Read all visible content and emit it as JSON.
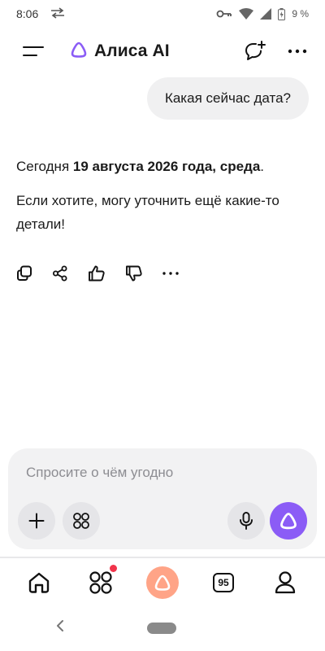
{
  "status_bar": {
    "time": "8:06",
    "battery": "9 %",
    "icons": [
      "data-transfer-icon",
      "vpn-key-icon",
      "wifi-icon",
      "signal-icon",
      "battery-icon"
    ]
  },
  "header": {
    "title": "Алиса AI",
    "icons": [
      "menu-icon",
      "alice-logo-icon",
      "new-chat-icon",
      "more-icon"
    ]
  },
  "chat": {
    "user_message": "Какая сейчас дата?",
    "answer": {
      "line1_prefix": "Сегодня ",
      "line1_bold": "19 августа 2026 года, среда",
      "line1_suffix": ".",
      "line2": "Если хотите, могу уточнить ещё какие-то детали!"
    },
    "reactions": [
      "copy-icon",
      "share-icon",
      "like-icon",
      "dislike-icon",
      "more-icon"
    ]
  },
  "composer": {
    "placeholder": "Спросите о чём угодно",
    "buttons": [
      "plus-icon",
      "apps-icon",
      "microphone-icon",
      "alice-send-icon"
    ]
  },
  "bottom_nav": {
    "items": [
      "home-icon",
      "services-icon",
      "alice-icon",
      "tabs-icon",
      "profile-icon"
    ],
    "tabs_count": "95",
    "notification_dot_color": "#f1344b"
  },
  "colors": {
    "accent": "#8b5cf6",
    "alice_nav": "#ffa487",
    "bubble_bg": "#f0f0f1",
    "composer_bg": "#f2f2f3"
  }
}
